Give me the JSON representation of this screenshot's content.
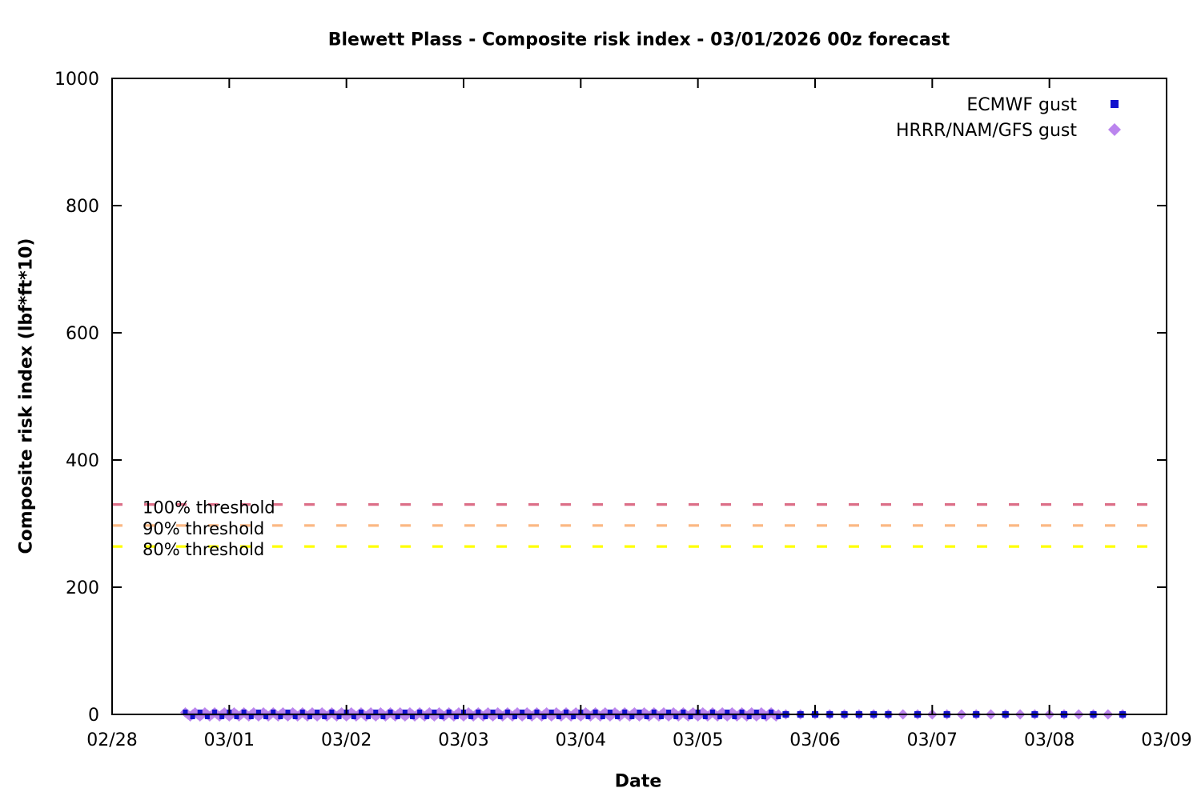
{
  "chart_data": {
    "type": "scatter",
    "title": "Blewett Plass - Composite risk index - 03/01/2026 00z forecast",
    "xlabel": "Date",
    "ylabel": "Composite risk index (lbf*ft*10)",
    "x_axis": {
      "tick_labels": [
        "02/28",
        "03/01",
        "03/02",
        "03/03",
        "03/04",
        "03/05",
        "03/06",
        "03/07",
        "03/08",
        "03/09"
      ],
      "unit": "date"
    },
    "y_axis": {
      "ticks": [
        "0",
        "200",
        "400",
        "600",
        "800",
        "1000"
      ],
      "range": [
        0,
        1000
      ]
    },
    "grid": false,
    "legend_position": "top-right",
    "thresholds": [
      {
        "label": "100% threshold",
        "value": 330,
        "color": "#dc6f88"
      },
      {
        "label": "90% threshold",
        "value": 297,
        "color": "#fbb884"
      },
      {
        "label": "80% threshold",
        "value": 264,
        "color": "#ffff00"
      }
    ],
    "series": [
      {
        "name": "ECMWF gust",
        "marker": "square",
        "color": "#1212cd",
        "y_value": 0,
        "segments_days_from_0228": [
          {
            "start": 0.625,
            "end": 5.6875,
            "step": 0.0625
          },
          {
            "start": 5.75,
            "end": 6.625,
            "step": 0.125
          },
          {
            "start": 6.875,
            "end": 8.625,
            "step": 0.25
          }
        ]
      },
      {
        "name": "HRRR/NAM/GFS gust",
        "marker": "diamond",
        "color": "#bb85ee",
        "y_value": 0,
        "segments_days_from_0228": [
          {
            "start": 0.625,
            "end": 5.6875,
            "step": 0.020833
          },
          {
            "start": 5.75,
            "end": 8.625,
            "step": 0.125
          }
        ]
      }
    ],
    "band_stripe_color": "#5b35c9"
  }
}
